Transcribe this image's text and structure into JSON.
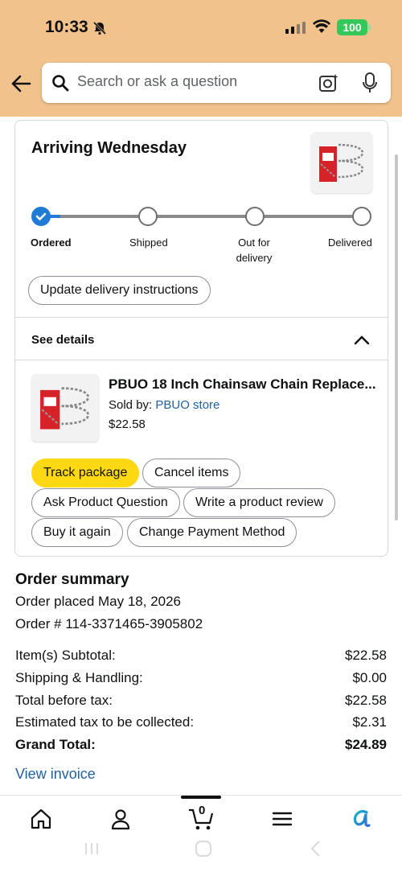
{
  "status": {
    "time": "10:33",
    "battery": "100"
  },
  "search": {
    "placeholder": "Search or ask a question"
  },
  "delivery": {
    "heading": "Arriving Wednesday",
    "steps": [
      "Ordered",
      "Shipped",
      "Out for delivery",
      "Delivered"
    ],
    "current_step": 1,
    "update_button": "Update delivery instructions"
  },
  "details": {
    "label": "See details",
    "product": {
      "title": "PBUO 18 Inch Chainsaw Chain Replace...",
      "sold_by_label": "Sold by:",
      "store": "PBUO store",
      "price": "$22.58"
    },
    "buttons": {
      "track": "Track package",
      "cancel": "Cancel items",
      "ask": "Ask Product Question",
      "review": "Write a product review",
      "buy_again": "Buy it again",
      "payment": "Change Payment Method"
    }
  },
  "summary": {
    "title": "Order summary",
    "placed": "Order placed May 18, 2026",
    "order_number": "Order # 114-3371465-3905802",
    "rows": [
      {
        "label": "Item(s) Subtotal:",
        "value": "$22.58"
      },
      {
        "label": "Shipping & Handling:",
        "value": "$0.00"
      },
      {
        "label": "Total before tax:",
        "value": "$22.58"
      },
      {
        "label": "Estimated tax to be collected:",
        "value": "$2.31"
      },
      {
        "label": "Grand Total:",
        "value": "$24.89"
      }
    ],
    "view_invoice": "View invoice"
  },
  "nav": {
    "cart_count": "0"
  },
  "colors": {
    "header": "#f2c28c",
    "accent_blue": "#1f7bd6",
    "link": "#2162a1",
    "track_button": "#ffd814"
  }
}
